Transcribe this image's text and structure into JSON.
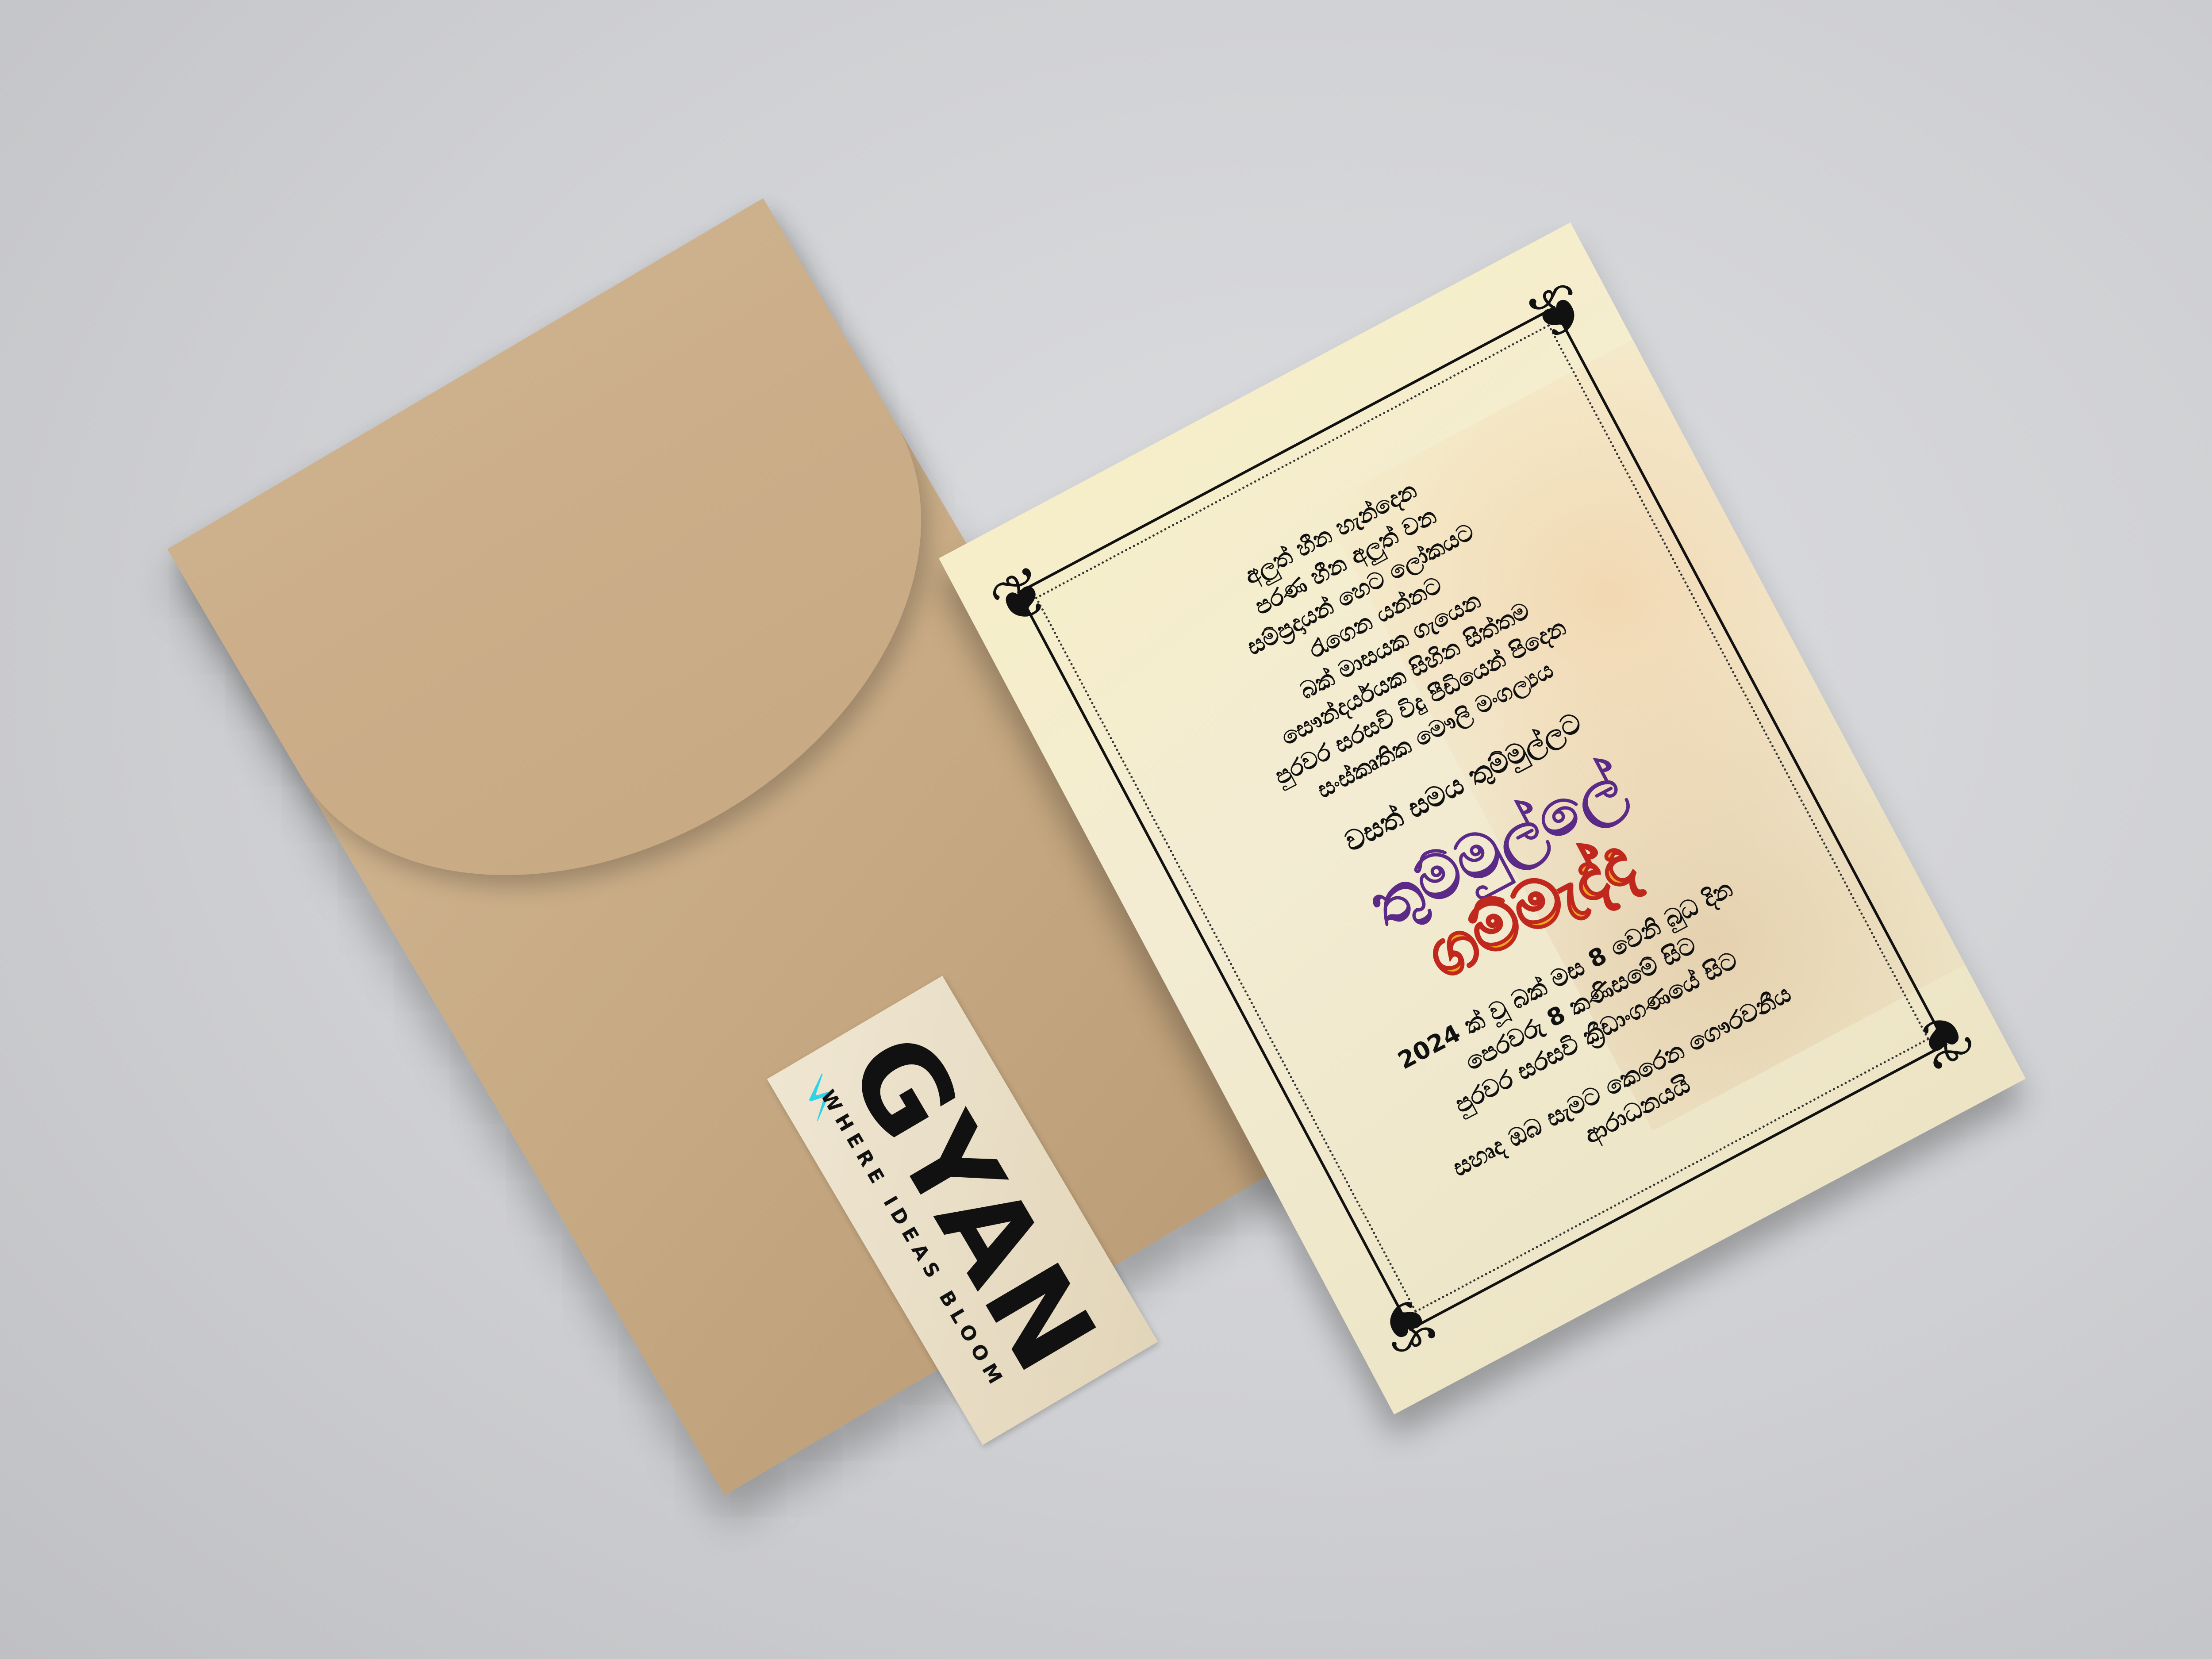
{
  "envelope": {
    "sticker": {
      "logo_text": "GYAN",
      "tagline": "WHERE IDEAS BLOOM",
      "accent_color": "#2fd3e6"
    },
    "color": "#c8aa84"
  },
  "card": {
    "poem": [
      "අලුත් හීන හැන්දෙන",
      "පරණ හීන අලුත් වන",
      "සම්ප්‍රදායන් හෙට ලෝකයට",
      "රැගෙන යන්නට",
      "බක් මාසයක ගැයෙන",
      "සෞන්දර්යයක සිහින සිත්තම",
      "පුරවර සරසවි විදු පීඩියෙන් පිදෙන",
      "සංස්කෘතික මෞලි මංගල්‍යය"
    ],
    "subtitle": "වසත් සමය තුම්මුල්ලට",
    "title_line1": "තුම්මුල්ලේ",
    "title_line2": "ගම්මැද්ද",
    "details": [
      "2024 ක් වූ බක් මස  8 වෙනි බුධ දින",
      "පෙරවරු 8 කණිසමේ සිට",
      "පුරවර සරසවි ක්‍රීඩාංගණයේ සිට"
    ],
    "closing": [
      "සහෘද ඔබ සැමට කෙරෙන ගෞරවනීය",
      "ආරාධනයයි"
    ],
    "title_colors": {
      "line1": "#5a2a86",
      "line2": "#f0a516",
      "outline": "#c0281e"
    }
  }
}
